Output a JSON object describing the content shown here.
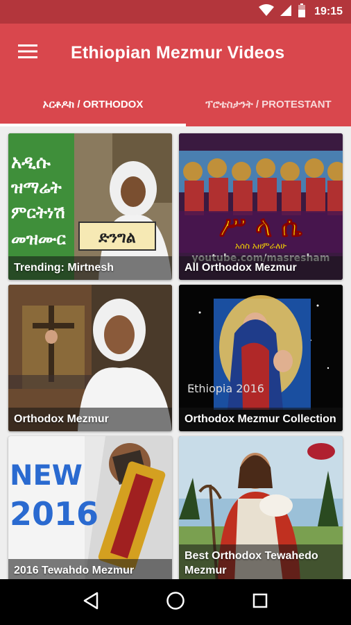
{
  "status_bar": {
    "time": "19:15",
    "icons": [
      "wifi-icon",
      "cell-signal-icon",
      "battery-icon"
    ]
  },
  "toolbar": {
    "title": "Ethiopian Mezmur Videos",
    "menu_icon": "hamburger-menu-icon"
  },
  "tabs": [
    {
      "label": "ኦርቶዶክ / ORTHODOX",
      "selected": true
    },
    {
      "label": "ፕሮቴስታንት / PROTESTANT",
      "selected": false
    }
  ],
  "cards": [
    {
      "label": "Trending: Mirtnesh",
      "thumb_text": [
        "አዲሱ",
        "ዝማሬት",
        "ምርትነሽ",
        "መዝሙር"
      ],
      "badge_text": "ድንግል"
    },
    {
      "label": "All Orthodox Mezmur",
      "thumb_text": [
        "ሥ ላ ሴ"
      ],
      "thumb_sub": "አሰስ አዘምራለሁ",
      "thumb_url": "youtube.com/masresham"
    },
    {
      "label": "Orthodox Mezmur"
    },
    {
      "label": "Orthodox Mezmur Collection",
      "thumb_text": [
        "Ethiopia 2016"
      ]
    },
    {
      "label": "2016 Tewahdo Mezmur",
      "thumb_text": [
        "NEW",
        "2016"
      ]
    },
    {
      "label": "Best Orthodox Tewahedo Mezmur"
    }
  ],
  "nav_bar": {
    "icons": [
      "back-triangle-icon",
      "home-circle-icon",
      "recents-square-icon"
    ]
  },
  "colors": {
    "status_bar": "#b3363c",
    "app_bar": "#d9474d",
    "background": "#eeeeee"
  }
}
